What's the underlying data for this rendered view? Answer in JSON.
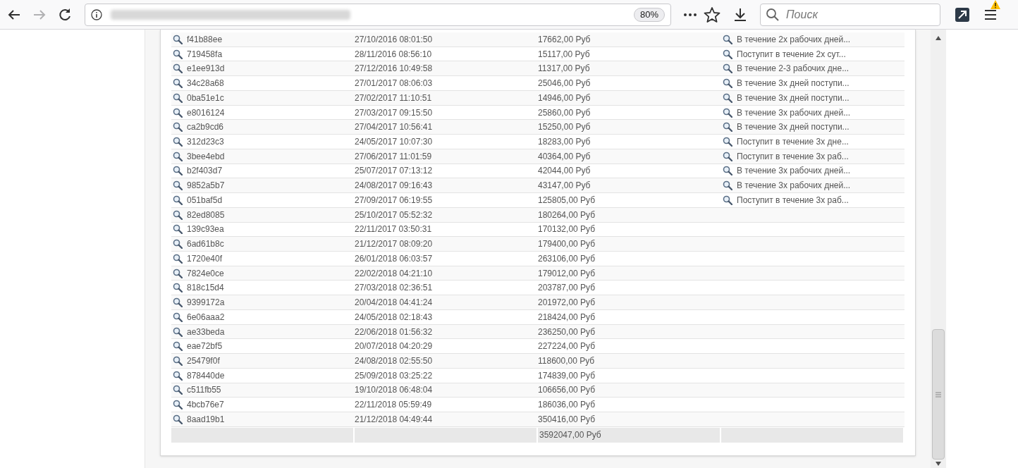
{
  "toolbar": {
    "back_disabled": false,
    "forward_disabled": true,
    "zoom": "80%",
    "search": {
      "placeholder": "Поиск"
    },
    "menu_warning": true
  },
  "table": {
    "rows": [
      {
        "id": "f41b88ee",
        "date": "27/10/2016 08:01:50",
        "amount": "17662,00 Руб",
        "note": "В течение 2х рабочих дней..."
      },
      {
        "id": "719458fa",
        "date": "28/11/2016 08:56:10",
        "amount": "15117,00 Руб",
        "note": "Поступит в течение 2х сут..."
      },
      {
        "id": "e1ee913d",
        "date": "27/12/2016 10:49:58",
        "amount": "11317,00 Руб",
        "note": "В течение 2-3 рабочих дне..."
      },
      {
        "id": "34c28a68",
        "date": "27/01/2017 08:06:03",
        "amount": "25046,00 Руб",
        "note": "В течение 3х дней поступи..."
      },
      {
        "id": "0ba51e1c",
        "date": "27/02/2017 11:10:51",
        "amount": "14946,00 Руб",
        "note": "В течение 3х дней поступи..."
      },
      {
        "id": "e8016124",
        "date": "27/03/2017 09:15:50",
        "amount": "25860,00 Руб",
        "note": "В течение 3х рабочих дней..."
      },
      {
        "id": "ca2b9cd6",
        "date": "27/04/2017 10:56:41",
        "amount": "15250,00 Руб",
        "note": "В течение 3х дней поступи..."
      },
      {
        "id": "312d23c3",
        "date": "24/05/2017 10:07:30",
        "amount": "18283,00 Руб",
        "note": "Поступит в течение 3х дне..."
      },
      {
        "id": "3bee4ebd",
        "date": "27/06/2017 11:01:59",
        "amount": "40364,00 Руб",
        "note": "Поступит в течение 3х раб..."
      },
      {
        "id": "b2f403d7",
        "date": "25/07/2017 07:13:12",
        "amount": "42044,00 Руб",
        "note": "В течение 3х рабочих дней..."
      },
      {
        "id": "9852a5b7",
        "date": "24/08/2017 09:16:43",
        "amount": "43147,00 Руб",
        "note": "В течение 3х рабочих дней..."
      },
      {
        "id": "051baf5d",
        "date": "27/09/2017 06:19:55",
        "amount": "125805,00 Руб",
        "note": "Поступит в течение 3х раб..."
      },
      {
        "id": "82ed8085",
        "date": "25/10/2017 05:52:32",
        "amount": "180264,00 Руб"
      },
      {
        "id": "139c93ea",
        "date": "22/11/2017 03:50:31",
        "amount": "170132,00 Руб"
      },
      {
        "id": "6ad61b8c",
        "date": "21/12/2017 08:09:20",
        "amount": "179400,00 Руб"
      },
      {
        "id": "1720e40f",
        "date": "26/01/2018 06:03:57",
        "amount": "263106,00 Руб"
      },
      {
        "id": "7824e0ce",
        "date": "22/02/2018 04:21:10",
        "amount": "179012,00 Руб"
      },
      {
        "id": "818c15d4",
        "date": "27/03/2018 02:36:51",
        "amount": "203787,00 Руб"
      },
      {
        "id": "9399172a",
        "date": "20/04/2018 04:41:24",
        "amount": "201972,00 Руб"
      },
      {
        "id": "6e06aaa2",
        "date": "24/05/2018 02:18:43",
        "amount": "218424,00 Руб"
      },
      {
        "id": "ae33beda",
        "date": "22/06/2018 01:56:32",
        "amount": "236250,00 Руб"
      },
      {
        "id": "eae72bf5",
        "date": "20/07/2018 04:20:29",
        "amount": "227224,00 Руб"
      },
      {
        "id": "25479f0f",
        "date": "24/08/2018 02:55:50",
        "amount": "118600,00 Руб"
      },
      {
        "id": "878440de",
        "date": "25/09/2018 03:25:22",
        "amount": "174839,00 Руб"
      },
      {
        "id": "c511fb55",
        "date": "19/10/2018 06:48:04",
        "amount": "106656,00 Руб"
      },
      {
        "id": "4bcb76e7",
        "date": "22/11/2018 05:59:49",
        "amount": "186036,00 Руб"
      },
      {
        "id": "8aad19b1",
        "date": "21/12/2018 04:49:44",
        "amount": "350416,00 Руб"
      }
    ],
    "total": "3592047,00 Руб"
  }
}
